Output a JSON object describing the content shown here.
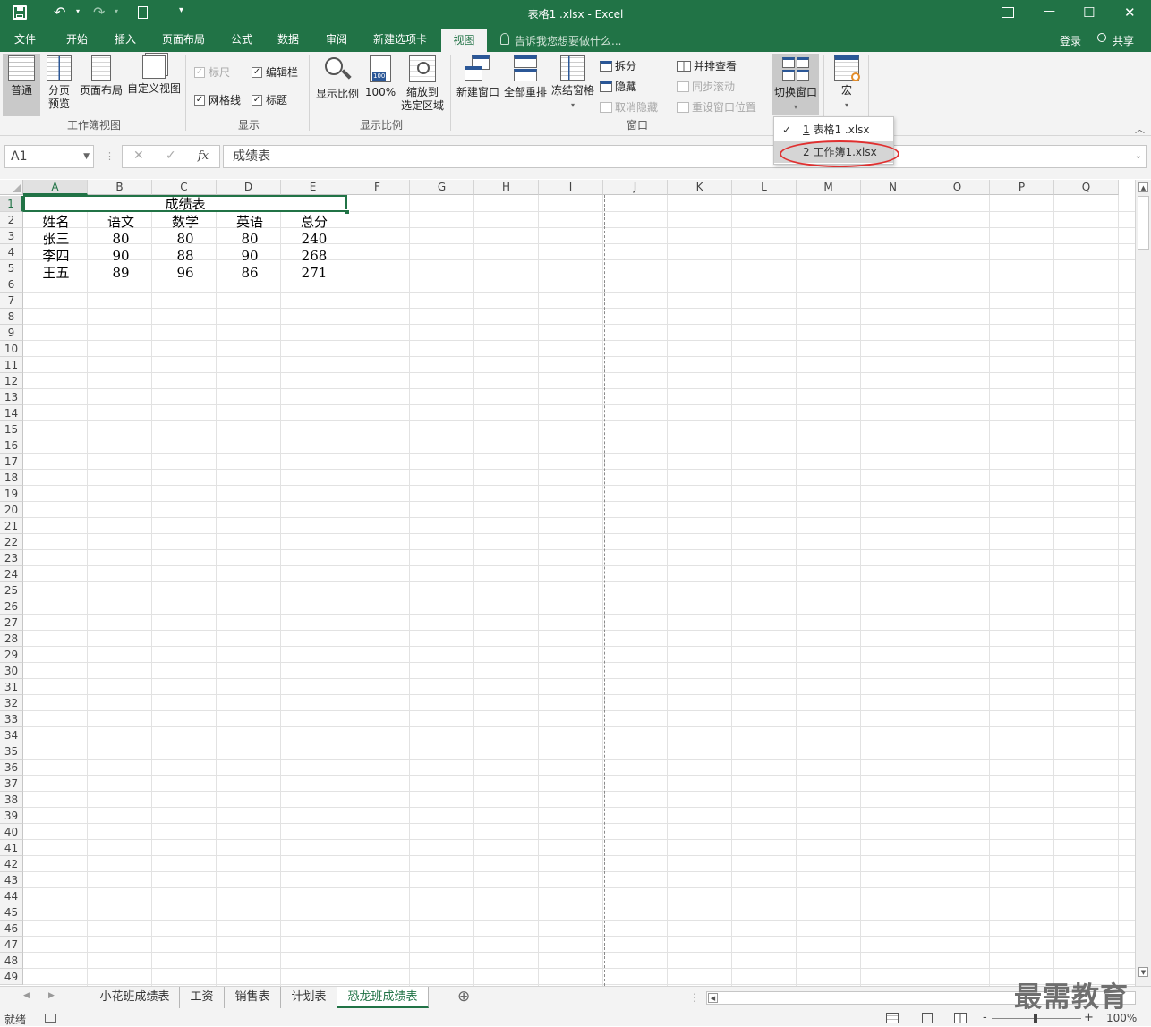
{
  "window": {
    "title": "表格1 .xlsx - Excel"
  },
  "quick_access": {
    "save": "save-icon",
    "undo": "undo-icon",
    "redo": "redo-icon",
    "new": "new-file-icon",
    "customize": "▾"
  },
  "window_controls": {
    "ribbon_display": "ribbon-display-icon",
    "minimize": "—",
    "maximize": "☐",
    "close": "✕"
  },
  "tabs": [
    {
      "label": "文件"
    },
    {
      "label": "开始"
    },
    {
      "label": "插入"
    },
    {
      "label": "页面布局"
    },
    {
      "label": "公式"
    },
    {
      "label": "数据"
    },
    {
      "label": "审阅"
    },
    {
      "label": "新建选项卡"
    },
    {
      "label": "视图"
    }
  ],
  "tell_me": "告诉我您想要做什么...",
  "login": "登录",
  "share": "共享",
  "ribbon": {
    "workbook_views": {
      "label": "工作簿视图",
      "normal": "普通",
      "page_break_1": "分页",
      "page_break_2": "预览",
      "page_layout": "页面布局",
      "custom_views": "自定义视图"
    },
    "show": {
      "label": "显示",
      "ruler": "标尺",
      "formula_bar": "编辑栏",
      "gridlines": "网格线",
      "headings": "标题",
      "check": "✓"
    },
    "zoom": {
      "label": "显示比例",
      "zoom": "显示比例",
      "hundred": "100%",
      "hundred_icon_text": "100",
      "zoom_sel_1": "缩放到",
      "zoom_sel_2": "选定区域"
    },
    "window": {
      "label": "窗口",
      "new_window": "新建窗口",
      "arrange_all": "全部重排",
      "freeze": "冻结窗格",
      "split": "拆分",
      "hide": "隐藏",
      "unhide": "取消隐藏",
      "side_by_side": "并排查看",
      "sync_scroll": "同步滚动",
      "reset_pos": "重设窗口位置",
      "switch": "切换窗口"
    },
    "macros": {
      "label": "宏"
    }
  },
  "switch_dropdown": {
    "items": [
      {
        "num": "1",
        "name": " 表格1 .xlsx",
        "checked": "✓"
      },
      {
        "num": "2",
        "name": " 工作簿1.xlsx",
        "checked": ""
      }
    ],
    "highlight_color": "#e03030"
  },
  "formula_bar": {
    "namebox": "A1",
    "cancel": "✕",
    "enter": "✓",
    "fx": "fx",
    "content": "成绩表"
  },
  "columns": [
    "A",
    "B",
    "C",
    "D",
    "E",
    "F",
    "G",
    "H",
    "I",
    "J",
    "K",
    "L",
    "M",
    "N",
    "O",
    "P",
    "Q"
  ],
  "rows": [
    "1",
    "2",
    "3",
    "4",
    "5",
    "6",
    "7",
    "8",
    "9",
    "10",
    "11",
    "12",
    "13",
    "14",
    "15",
    "16",
    "17",
    "18",
    "19",
    "20",
    "21",
    "22",
    "23",
    "24",
    "25",
    "26",
    "27",
    "28",
    "29",
    "30",
    "31",
    "32",
    "33",
    "34",
    "35",
    "36",
    "37",
    "38",
    "39",
    "40",
    "41",
    "42",
    "43",
    "44",
    "45",
    "46",
    "47",
    "48",
    "49"
  ],
  "sheet": {
    "title": "成绩表",
    "headers": [
      "姓名",
      "语文",
      "数学",
      "英语",
      "总分"
    ],
    "data": [
      [
        "张三",
        "80",
        "80",
        "80",
        "240"
      ],
      [
        "李四",
        "90",
        "88",
        "90",
        "268"
      ],
      [
        "王五",
        "89",
        "96",
        "86",
        "271"
      ]
    ]
  },
  "sheet_tabs": [
    "小花班成绩表",
    "工资",
    "销售表",
    "计划表",
    "恐龙班成绩表"
  ],
  "active_sheet": "恐龙班成绩表",
  "add_sheet": "⊕",
  "status": {
    "ready": "就绪",
    "zoom": "100%",
    "minus": "-",
    "plus": "+"
  },
  "watermark": "最需教育",
  "colors": {
    "brand": "#217346",
    "ribbon_bg": "#f3f3f3"
  }
}
